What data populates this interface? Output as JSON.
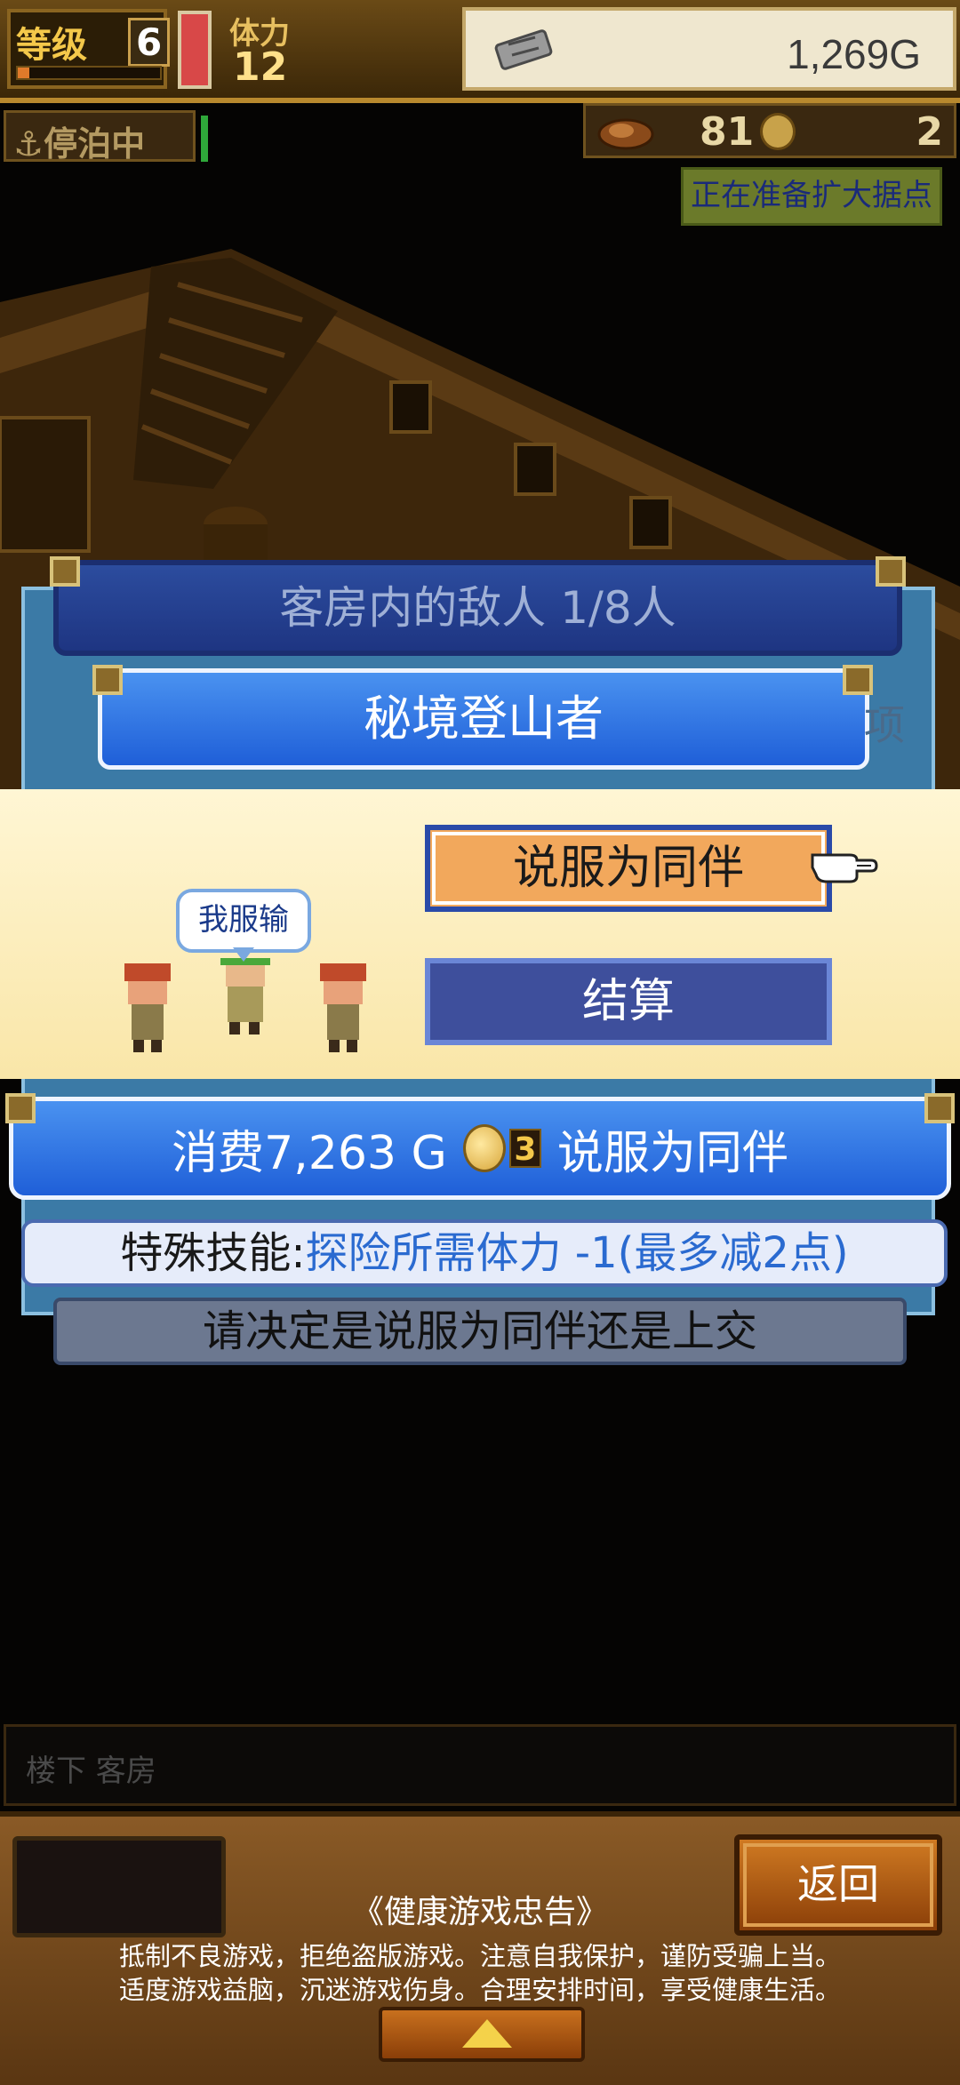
{
  "hud": {
    "level_label": "等级",
    "level_value": "6",
    "level_progress": 0.08,
    "stamina_label": "体力",
    "stamina_value": "12",
    "gold_value": "1,269G",
    "status_label": "停泊中",
    "resource_1": "81",
    "resource_2": "2",
    "notice": "正在准备扩大据点"
  },
  "modal": {
    "header": "客房内的敌人  1/8人",
    "enemy_name": "秘境登山者",
    "peek_text": "项",
    "speech": "我服输",
    "persuade_label": "说服为同伴",
    "settle_label": "结算",
    "cost_prefix": "消费7,263 G",
    "coin_count": "3",
    "cost_action": "说服为同伴",
    "skill_label": "特殊技能:",
    "skill_desc": "探险所需体力 -1(最多减2点)",
    "instruction": "请决定是说服为同伴还是上交"
  },
  "location": "楼下 客房",
  "footer": {
    "back_label": "返回",
    "health_title": "《健康游戏忠告》",
    "health_line1": "抵制不良游戏，拒绝盗版游戏。注意自我保护，谨防受骗上当。",
    "health_line2": "适度游戏益脑，沉迷游戏伤身。合理安排时间，享受健康生活。"
  },
  "icons": [
    "anchor-icon",
    "ship-icon",
    "ticket-icon",
    "coin-icon",
    "pointer-hand-icon",
    "up-arrow-icon"
  ],
  "colors": {
    "accent_blue": "#1f5fd8",
    "panel_yellow": "#fff6d4",
    "button_orange": "#f2a85c",
    "wood": "#8a5a26"
  }
}
